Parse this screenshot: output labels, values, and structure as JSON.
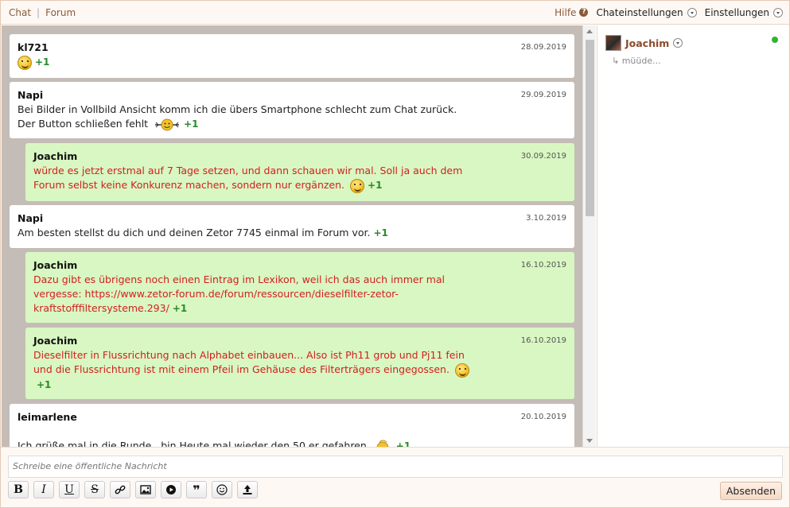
{
  "topbar": {
    "crumb_chat": "Chat",
    "crumb_sep": "|",
    "crumb_forum": "Forum",
    "help": "Hilfe",
    "chat_settings": "Chateinstellungen",
    "settings": "Einstellungen"
  },
  "messages": [
    {
      "author": "kl721",
      "date": "28.09.2019",
      "body": "",
      "emoji": "smiley-face-icon",
      "plus": "+1"
    },
    {
      "author": "Napi",
      "date": "29.09.2019",
      "body1": "Bei Bilder in Vollbild Ansicht komm ich die übers Smartphone schlecht zum Chat zurück.",
      "body2": "Der Button schließen fehlt",
      "emoji": "waving-smiley-icon",
      "plus": "+1"
    },
    {
      "author": "Joachim",
      "date": "30.09.2019",
      "body": "würde es jetzt erstmal auf 7 Tage setzen, und dann schauen wir mal. Soll ja auch dem Forum selbst keine Konkurenz machen, sondern nur ergänzen.",
      "emoji": "smiley-face-icon",
      "plus": "+1"
    },
    {
      "author": "Napi",
      "date": "3.10.2019",
      "body": "Am besten stellst du dich und deinen Zetor 7745 einmal im Forum vor.",
      "plus": "+1"
    },
    {
      "author": "Joachim",
      "date": "16.10.2019",
      "body": "Dazu gibt es übrigens noch einen Eintrag im Lexikon, weil ich das auch immer mal vergesse: https://www.zetor-forum.de/forum/ressourcen/dieselfilter-zetor-kraftstofffiltersysteme.293/",
      "plus": "+1"
    },
    {
      "author": "Joachim",
      "date": "16.10.2019",
      "body": "Dieselfilter in Flussrichtung nach Alphabet einbauen... Also ist Ph11 grob und Pj11 fein und die Flussrichtung ist mit einem Pfeil im Gehäuse des Filterträgers eingegossen.",
      "emoji": "smiley-face-icon",
      "plus": "+1"
    },
    {
      "author": "leimarlene",
      "date": "20.10.2019",
      "body": "Ich grüße mal in die Runde , bin Heute mal wieder den 50 er gefahren",
      "emoji": "waving-smiley-icon",
      "plus": "+1"
    }
  ],
  "sidebar": {
    "user_name": "Joachim",
    "user_status": "↳ müüde...",
    "online_color": "#2fb52f"
  },
  "composer": {
    "placeholder": "Schreibe eine öffentliche Nachricht",
    "send_label": "Absenden",
    "tools": [
      "bold-icon",
      "italic-icon",
      "underline-icon",
      "strikethrough-icon",
      "link-icon",
      "image-icon",
      "media-icon",
      "quote-icon",
      "emoji-icon",
      "upload-icon"
    ]
  }
}
